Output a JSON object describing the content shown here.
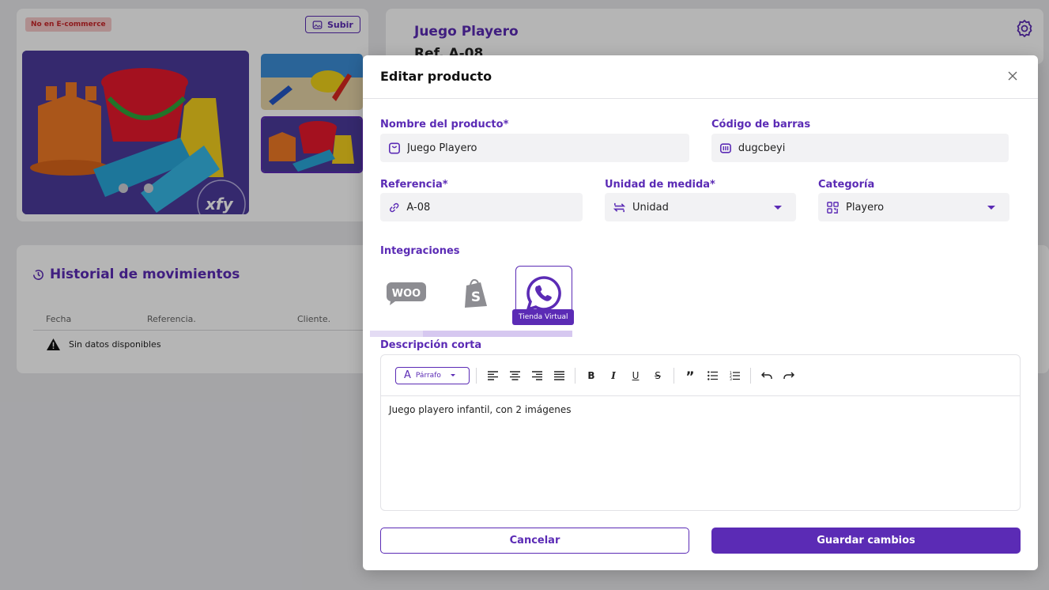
{
  "background": {
    "badge": "No en E-commerce",
    "upload_label": "Subir",
    "product_title": "Juego Playero",
    "product_ref": "Ref. A-08",
    "history_title": "Historial de movimientos",
    "columns": [
      "Fecha",
      "Referencia.",
      "Cliente."
    ],
    "no_data": "Sin datos disponibles",
    "watermark": "xfy"
  },
  "modal": {
    "title": "Editar producto",
    "fields": {
      "name": {
        "label": "Nombre del producto*",
        "value": "Juego Playero"
      },
      "barcode": {
        "label": "Código de barras",
        "value": "dugcbeyi"
      },
      "reference": {
        "label": "Referencia*",
        "value": "A-08"
      },
      "unit": {
        "label": "Unidad de medida*",
        "value": "Unidad"
      },
      "category": {
        "label": "Categoría",
        "value": "Playero"
      }
    },
    "integrations": {
      "label": "Integraciones",
      "items": [
        {
          "name": "WooCommerce",
          "icon": "woocommerce-icon"
        },
        {
          "name": "Shopify",
          "icon": "shopify-icon"
        },
        {
          "name": "Tienda Virtual",
          "icon": "whatsapp-icon",
          "active": true
        }
      ],
      "tooltip": "Tienda Virtual"
    },
    "description": {
      "label": "Descripción corta",
      "paragraph_select": "Párrafo",
      "content": "Juego playero infantil, con 2 imágenes"
    },
    "buttons": {
      "cancel": "Cancelar",
      "save": "Guardar cambios"
    }
  },
  "colors": {
    "accent": "#5b2bb5",
    "badge_bg": "#f6c9c9",
    "badge_text": "#c8262a"
  }
}
